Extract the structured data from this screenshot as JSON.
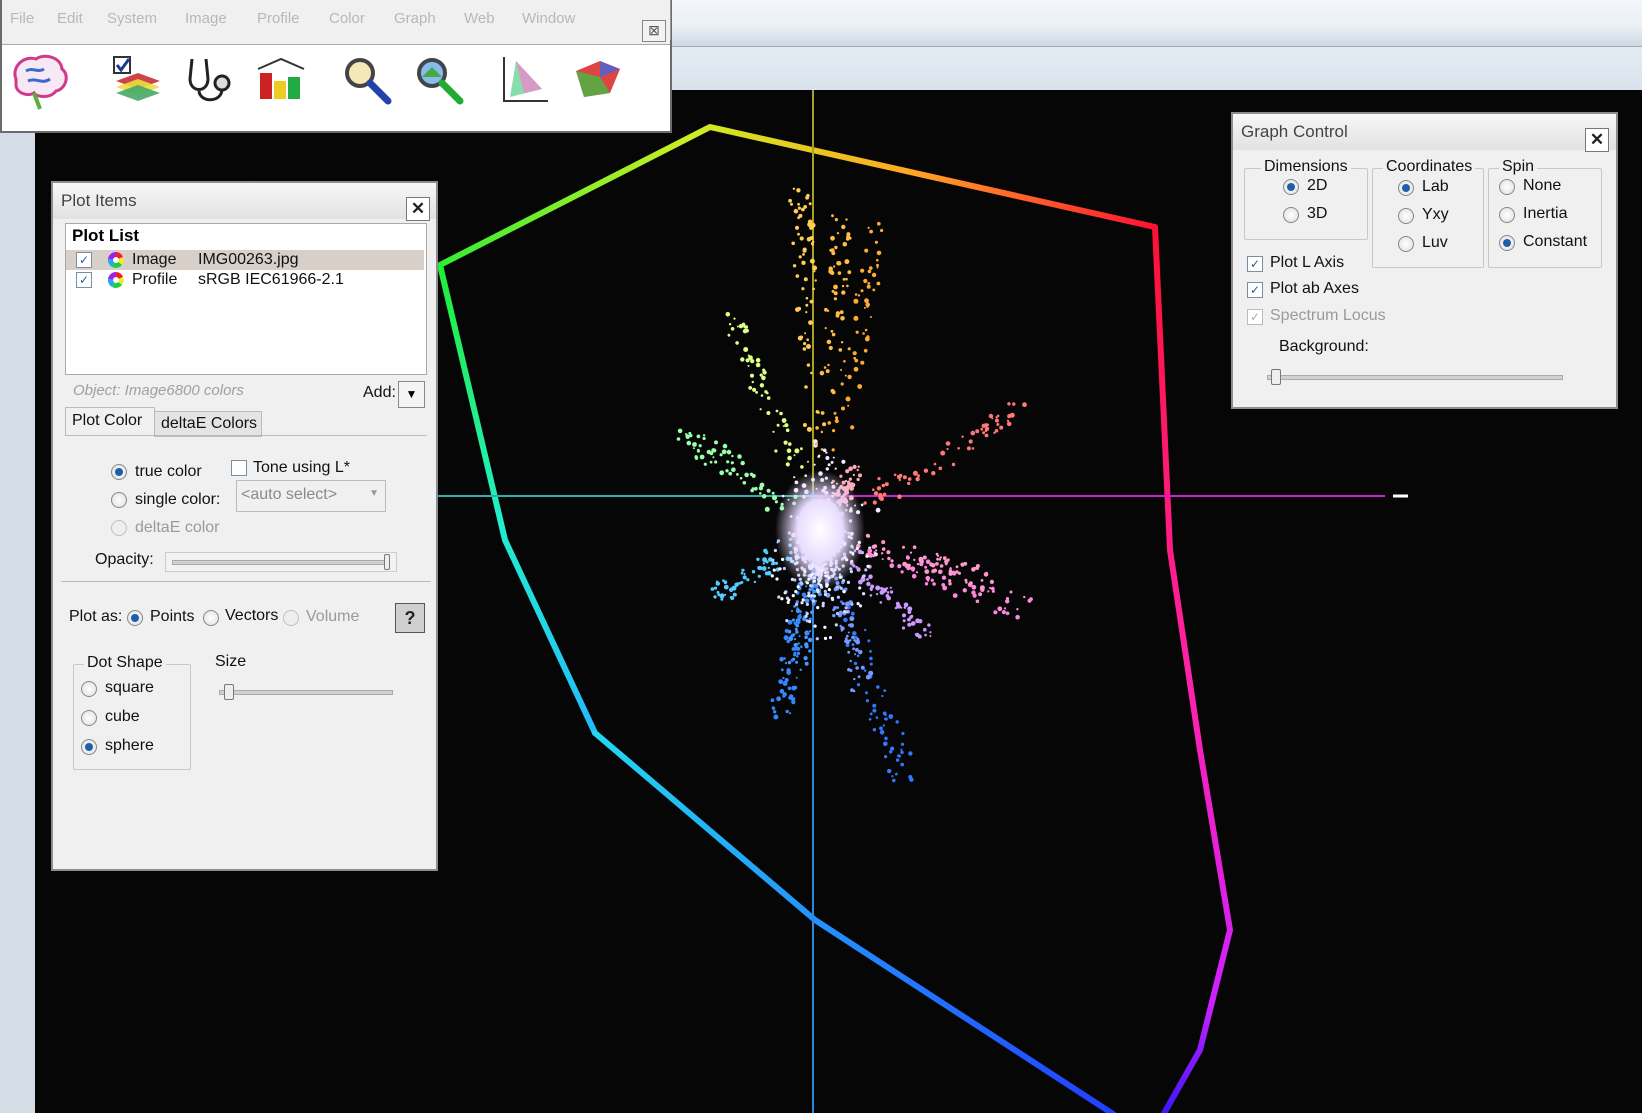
{
  "menu": {
    "items": [
      "File",
      "Edit",
      "System",
      "Image",
      "Profile",
      "Color",
      "Graph",
      "Web",
      "Window"
    ]
  },
  "toolbar": {
    "close_glyph": "⊠",
    "tools": [
      "brain-icon",
      "checklist-icon",
      "stethoscope-icon",
      "gamut-compare-icon",
      "magnifier-icon",
      "color-magnifier-icon",
      "chromaticity-icon",
      "gamut-3d-icon"
    ]
  },
  "plot_items": {
    "title": "Plot Items",
    "close_glyph": "✕",
    "plot_list_header": "Plot List",
    "rows": [
      {
        "checked": true,
        "type": "Image",
        "name": "IMG00263.jpg"
      },
      {
        "checked": true,
        "type": "Profile",
        "name": "sRGB IEC61966-2.1"
      }
    ],
    "object_text": "Object: Image6800 colors",
    "add_label": "Add:",
    "tabs": [
      "Plot Color",
      "deltaE Colors"
    ],
    "true_color": "true color",
    "single_color": "single color:",
    "deltae_color": "deltaE color",
    "tone_label": "Tone using L*",
    "select_value": "<auto select>",
    "opacity_label": "Opacity:",
    "plot_as_label": "Plot as:",
    "plot_as_options": [
      "Points",
      "Vectors",
      "Volume"
    ],
    "dot_shape_label": "Dot Shape",
    "dot_shapes": [
      "square",
      "cube",
      "sphere"
    ],
    "size_label": "Size",
    "help_glyph": "?"
  },
  "graph_control": {
    "title": "Graph Control",
    "close_glyph": "✕",
    "dimensions_label": "Dimensions",
    "dimensions": [
      "2D",
      "3D"
    ],
    "coordinates_label": "Coordinates",
    "coordinates": [
      "Lab",
      "Yxy",
      "Luv"
    ],
    "spin_label": "Spin",
    "spin": [
      "None",
      "Inertia",
      "Constant"
    ],
    "plot_l_axis": "Plot L Axis",
    "plot_ab_axes": "Plot ab Axes",
    "spectrum_locus": "Spectrum Locus",
    "background_label": "Background:"
  },
  "colors": {
    "accent": "#1f5fa8",
    "plot_bg": "#060606"
  }
}
